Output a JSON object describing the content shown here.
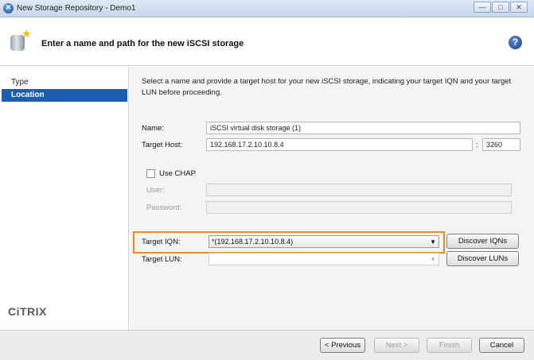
{
  "window": {
    "title": "New Storage Repository - Demo1",
    "controls": [
      "—",
      "□",
      "✕"
    ]
  },
  "header": {
    "title": "Enter a name and path for the new iSCSI storage",
    "help": "?"
  },
  "nav": {
    "items": [
      {
        "label": "Type",
        "selected": false
      },
      {
        "label": "Location",
        "selected": true
      }
    ],
    "logo": "CiTRIX"
  },
  "form": {
    "description": "Select a name and provide a target host for your new iSCSI storage, indicating your target IQN and your target LUN before proceeding.",
    "name_label": "Name:",
    "name_value": "iSCSI virtual disk storage (1)",
    "host_label": "Target Host:",
    "host_value": "192.168.17.2.10.10.8.4",
    "port_colon": ":",
    "port_value": "3260",
    "chap_label": "Use CHAP",
    "chap_checked": false,
    "user_label": "User:",
    "user_value": "",
    "password_label": "Password:",
    "password_value": "",
    "iqn_label": "Target IQN:",
    "iqn_value": "*(192.168.17.2.10.10.8.4)",
    "discover_iqns": "Discover IQNs",
    "lun_label": "Target LUN:",
    "lun_value": "",
    "discover_luns": "Discover LUNs",
    "highlight_color": "#f08a24"
  },
  "footer": {
    "previous": "< Previous",
    "next": "Next >",
    "finish": "Finish",
    "cancel": "Cancel"
  }
}
